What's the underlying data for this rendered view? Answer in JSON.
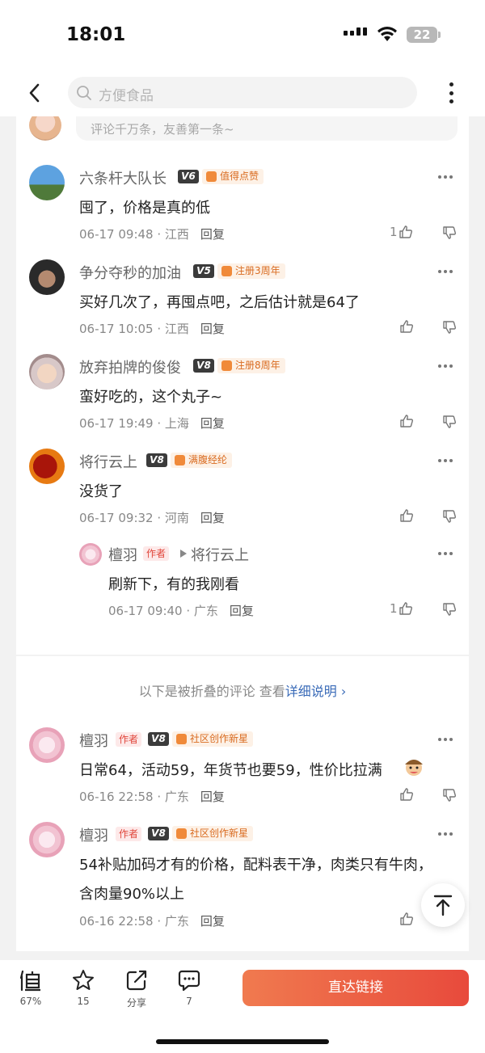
{
  "status": {
    "time": "18:01",
    "battery": "22"
  },
  "nav": {
    "search_placeholder": "方便食品"
  },
  "comment_box": {
    "placeholder": "评论千万条，友善第一条~"
  },
  "comments": [
    {
      "user": "六条杆大队长",
      "level": "V6",
      "tag": "值得点赞",
      "text": "囤了，价格是真的低",
      "time": "06-17 09:48",
      "region": "江西",
      "reply": "回复",
      "likes": "1"
    },
    {
      "user": "争分夺秒的加油",
      "level": "V5",
      "tag": "注册3周年",
      "text": "买好几次了，再囤点吧，之后估计就是64了",
      "time": "06-17 10:05",
      "region": "江西",
      "reply": "回复",
      "likes": ""
    },
    {
      "user": "放弃拍牌的俊俊",
      "level": "V8",
      "tag": "注册8周年",
      "text": "蛮好吃的，这个丸子~",
      "time": "06-17 19:49",
      "region": "上海",
      "reply": "回复",
      "likes": ""
    },
    {
      "user": "将行云上",
      "level": "V8",
      "tag": "满腹经纶",
      "text": "没货了",
      "time": "06-17 09:32",
      "region": "河南",
      "reply": "回复",
      "likes": ""
    }
  ],
  "sub_reply": {
    "user": "檀羽",
    "author_tag": "作者",
    "reply_to": "将行云上",
    "text": "刷新下，有的我刚看",
    "time": "06-17 09:40",
    "region": "广东",
    "reply": "回复",
    "likes": "1"
  },
  "fold": {
    "note": "以下是被折叠的评论 查看",
    "link": "详细说明 ›"
  },
  "folded_comments": [
    {
      "user": "檀羽",
      "author_tag": "作者",
      "level": "V8",
      "tag": "社区创作新星",
      "text": "日常64，活动59，年货节也要59，性价比拉满",
      "time": "06-16 22:58",
      "region": "广东",
      "reply": "回复"
    },
    {
      "user": "檀羽",
      "author_tag": "作者",
      "level": "V8",
      "tag": "社区创作新星",
      "text": "54补贴加码才有的价格，配料表干净，肉类只有牛肉，",
      "text2": "含肉量90%以上",
      "time": "06-16 22:58",
      "region": "广东",
      "reply": "回复"
    }
  ],
  "bottom": {
    "worth_label": "67%",
    "fav_label": "15",
    "share_label": "分享",
    "comment_label": "7",
    "direct_button": "直达链接"
  },
  "colors": {
    "accent": "#e84a3c",
    "tag_orange": "#d96b20",
    "link_blue": "#3a6bb8"
  }
}
